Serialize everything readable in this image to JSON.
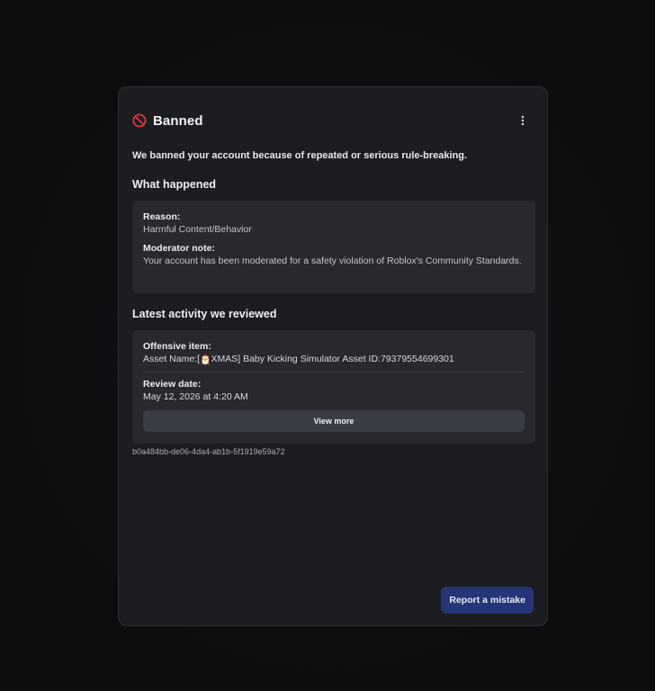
{
  "modal": {
    "title": "Banned",
    "title_icon": "ban-icon",
    "menu_icon": "more-vertical-icon",
    "intro": "We banned your account because of repeated or serious rule-breaking."
  },
  "what_happened": {
    "heading": "What happened",
    "reason_label": "Reason:",
    "reason_value": "Harmful Content/Behavior",
    "note_label": "Moderator note:",
    "note_value": "Your account has been moderated for a safety violation of Roblox's Community Standards."
  },
  "activity": {
    "heading": "Latest activity we reviewed",
    "item_label": "Offensive item:",
    "item_prefix": "Asset Name:[",
    "item_suffix": "XMAS] Baby Kicking Simulator Asset ID:79379554699301",
    "item_emoji": "🎅",
    "date_label": "Review date:",
    "date_value": "May 12, 2026 at 4:20 AM",
    "view_more_label": "View more"
  },
  "reference_id": "b0a484bb-de06-4da4-ab1b-5f1919e59a72",
  "footer": {
    "report_label": "Report a mistake"
  },
  "colors": {
    "background": "#0e0f11",
    "modal": "#1c1d21",
    "box": "#27292f",
    "ban_icon": "#e0383e",
    "report_button": "#263578"
  }
}
